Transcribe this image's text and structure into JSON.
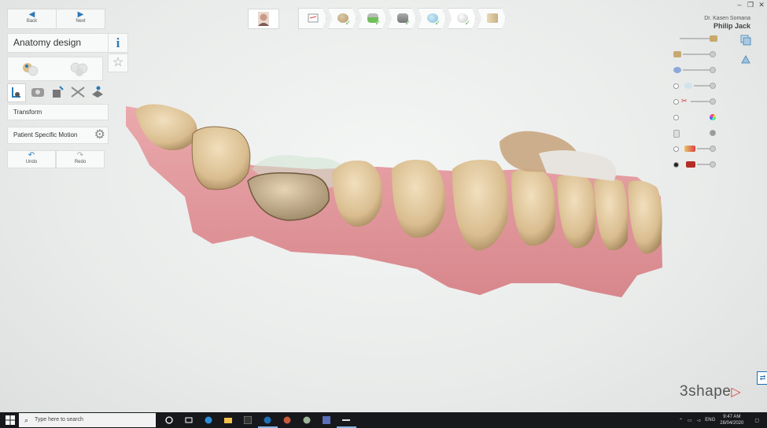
{
  "window": {
    "minimize": "–",
    "restore": "❐",
    "close": "✕"
  },
  "nav": {
    "back_label": "Back",
    "next_label": "Next"
  },
  "workflow_steps": [
    {
      "name": "order-form",
      "done": false
    },
    {
      "name": "preparation",
      "done": true
    },
    {
      "name": "margin-line",
      "done": true
    },
    {
      "name": "insertion-direction",
      "done": true
    },
    {
      "name": "die-settings",
      "done": true
    },
    {
      "name": "anatomy-design",
      "done": true,
      "active": true
    },
    {
      "name": "output",
      "done": false
    }
  ],
  "header": {
    "doctor": "Dr. Kasen Somana",
    "patient": "Philip Jack"
  },
  "left_panel": {
    "title": "Anatomy design",
    "info_glyph": "i",
    "transform_label": "Transform",
    "psm_label": "Patient Specific Motion",
    "undo_label": "Undo",
    "redo_label": "Redo"
  },
  "tools": [
    "transform-icon",
    "sculpt-icon",
    "morph-icon",
    "connector-icon",
    "smooth-icon"
  ],
  "visibility_sliders": [
    {
      "name": "antagonist",
      "radio": false
    },
    {
      "name": "die",
      "radio": false
    },
    {
      "name": "scan-blue",
      "radio": false
    },
    {
      "name": "pre-op",
      "radio": true
    },
    {
      "name": "cutter",
      "radio": true
    },
    {
      "name": "color",
      "radio": true
    },
    {
      "name": "gingiva",
      "radio": false
    },
    {
      "name": "restoration",
      "radio": true
    },
    {
      "name": "crown",
      "radio": true,
      "selected": true
    }
  ],
  "brand": {
    "logo_text": "3shape",
    "logo_mark": "▷"
  },
  "taskbar": {
    "search_placeholder": "Type here to search",
    "language": "ENG",
    "time": "9:47 AM",
    "date": "28/04/2020"
  },
  "colors": {
    "accent": "#2a7ab8",
    "check": "#5fb94a",
    "gingiva": "#e2a0a4",
    "tooth": "#dcc39a",
    "logo": "#e0403a"
  }
}
